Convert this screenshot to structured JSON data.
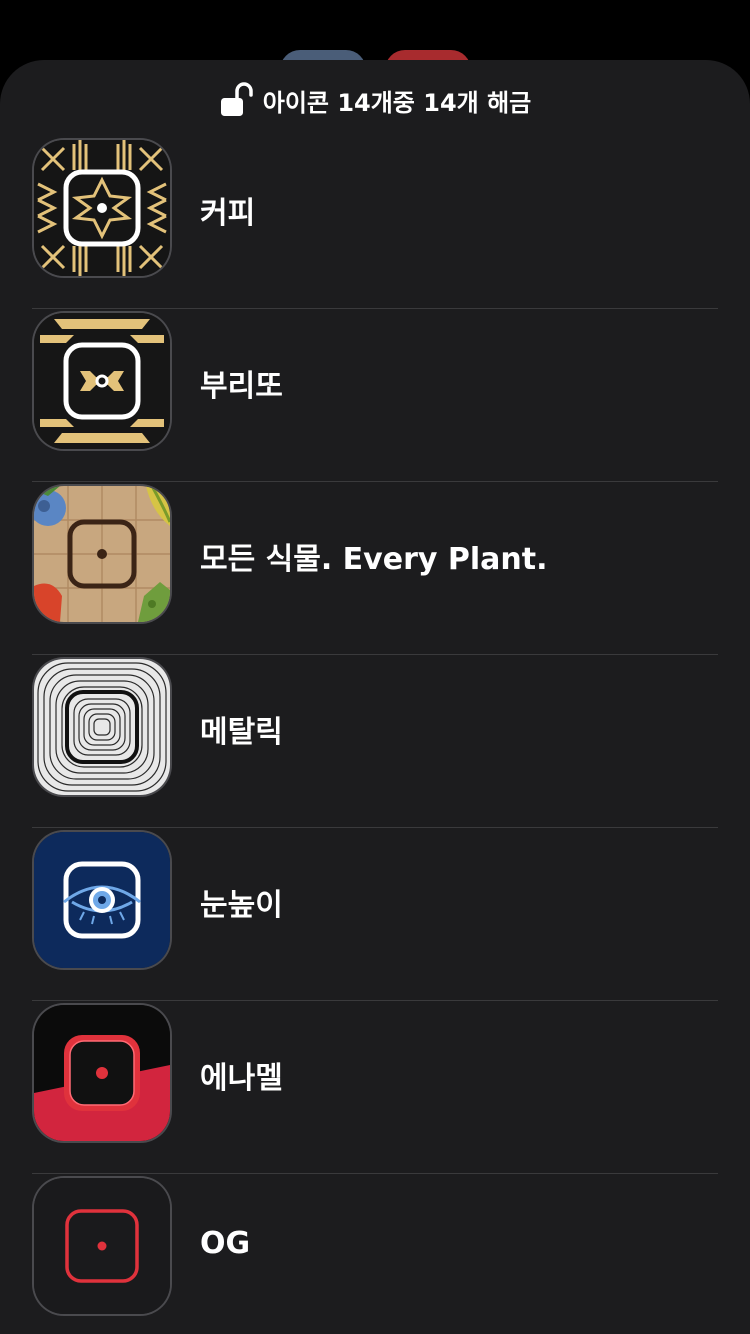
{
  "header": {
    "unlock_text": "아이콘 14개중 14개 해금"
  },
  "icons": [
    {
      "label": "커피",
      "icon": "coffee-pattern-icon"
    },
    {
      "label": "부리또",
      "icon": "burrito-pattern-icon"
    },
    {
      "label": "모든 식물. Every Plant.",
      "icon": "every-plant-icon"
    },
    {
      "label": "메탈릭",
      "icon": "metallic-icon"
    },
    {
      "label": "눈높이",
      "icon": "eye-level-icon"
    },
    {
      "label": "에나멜",
      "icon": "enamel-icon"
    },
    {
      "label": "OG",
      "icon": "og-icon"
    }
  ],
  "colors": {
    "sheet_bg": "#1c1c1e",
    "separator": "#3a3a3c",
    "gold": "#e3c27a",
    "accent_red": "#e0323c",
    "navy": "#0d2a5c"
  }
}
